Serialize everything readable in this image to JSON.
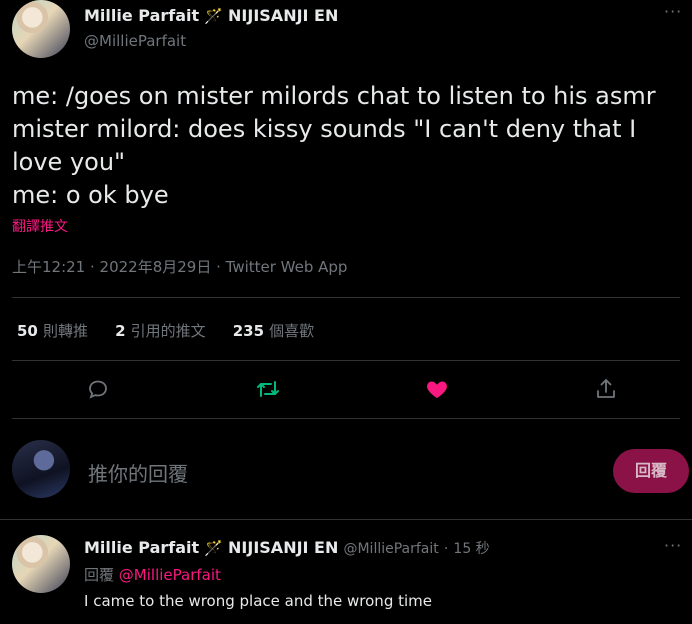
{
  "main_tweet": {
    "author_name": "Millie Parfait",
    "author_badge": "🪄",
    "author_org": "NIJISANJI EN",
    "author_handle": "@MillieParfait",
    "text_lines": [
      "me: /goes on mister milords chat to listen to his asmr",
      "mister milord: does kissy sounds \"I can't deny that I",
      "love you\"",
      "me: o ok bye"
    ],
    "translate_label": "翻譯推文",
    "timestamp": "上午12:21 · 2022年8月29日 · Twitter Web App"
  },
  "stats": {
    "retweets_count": "50",
    "retweets_label": "則轉推",
    "quotes_count": "2",
    "quotes_label": "引用的推文",
    "likes_count": "235",
    "likes_label": "個喜歡"
  },
  "actions": {
    "reply_icon": "reply-icon",
    "retweet_icon": "retweet-icon",
    "like_icon": "heart-icon",
    "share_icon": "share-icon",
    "retweet_color": "#00ba7c",
    "like_color": "#f91880"
  },
  "composer": {
    "placeholder": "推你的回覆",
    "button_label": "回覆"
  },
  "reply_tweet": {
    "author_name": "Millie Parfait",
    "author_badge": "🪄",
    "author_org": "NIJISANJI EN",
    "author_handle": "@MillieParfait",
    "time": "15 秒",
    "reply_prefix": "回覆",
    "reply_to": "@MillieParfait",
    "text": "I came to the wrong place and the wrong time"
  }
}
